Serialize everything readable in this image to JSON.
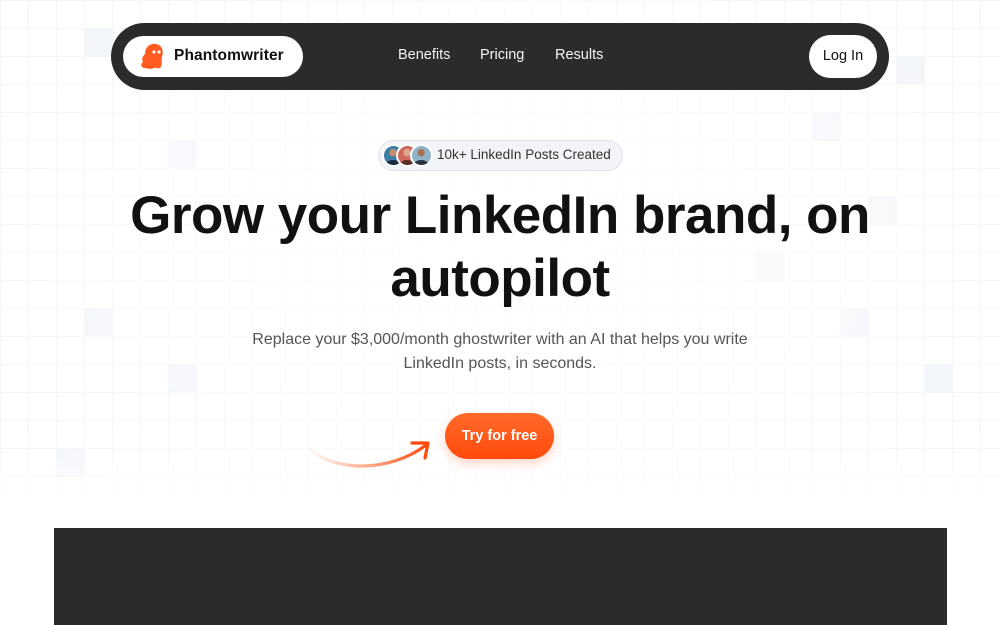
{
  "brand": {
    "name": "Phantomwriter",
    "icon": "ghost-icon",
    "accent": "#ff5a1f"
  },
  "nav": {
    "links": [
      {
        "label": "Benefits"
      },
      {
        "label": "Pricing"
      },
      {
        "label": "Results"
      }
    ],
    "login_label": "Log In"
  },
  "hero": {
    "badge_text": "10k+ LinkedIn Posts Created",
    "headline_line1": "Grow your LinkedIn brand, on",
    "headline_line2": "autopilot",
    "subtext_line1": "Replace your $3,000/month ghostwriter with an AI that helps you write",
    "subtext_line2": "LinkedIn posts, in seconds.",
    "cta_label": "Try for free"
  },
  "colors": {
    "nav_background": "#2b2b2b",
    "cta_gradient_top": "#ff6a2a",
    "cta_gradient_bottom": "#ff4a0c",
    "text_primary": "#111111",
    "text_secondary": "#555555"
  }
}
